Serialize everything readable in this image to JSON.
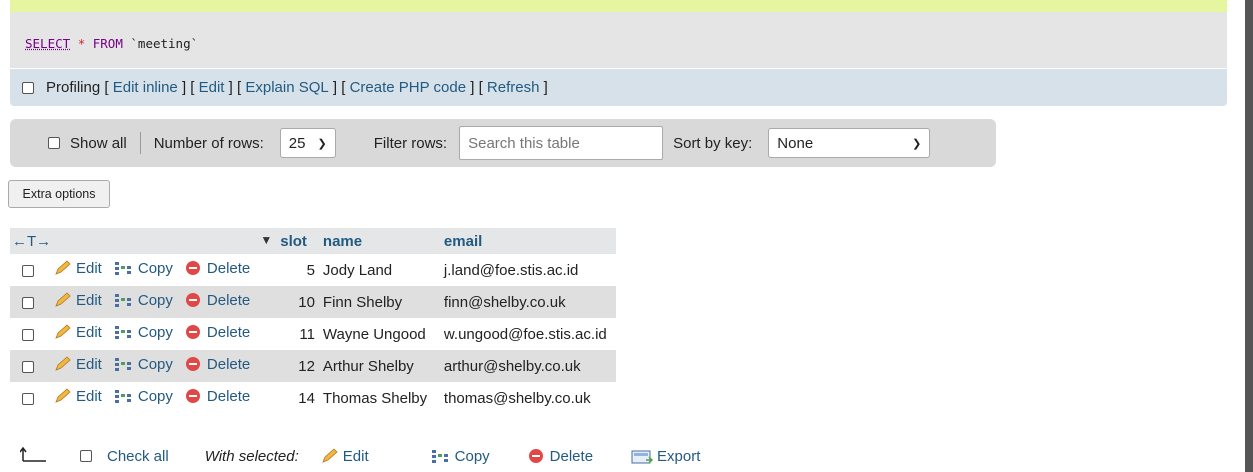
{
  "sql": {
    "select": "SELECT",
    "star": "*",
    "from": "FROM",
    "table": "`meeting`"
  },
  "profiling": {
    "label": "Profiling",
    "links": [
      "Edit inline",
      "Edit",
      "Explain SQL",
      "Create PHP code",
      "Refresh"
    ],
    "open": "[",
    "close": "]"
  },
  "nav": {
    "show_all": "Show all",
    "rows_label": "Number of rows:",
    "rows_value": "25",
    "filter_label": "Filter rows:",
    "filter_placeholder": "Search this table",
    "sort_label": "Sort by key:",
    "sort_value": "None"
  },
  "extra_options": "Extra options",
  "table": {
    "headers": {
      "arrows": "←T→",
      "slot": "slot",
      "name": "name",
      "email": "email"
    },
    "actions": {
      "edit": "Edit",
      "copy": "Copy",
      "delete": "Delete"
    },
    "rows": [
      {
        "slot": "5",
        "name": "Jody Land",
        "email": "j.land@foe.stis.ac.id"
      },
      {
        "slot": "10",
        "name": "Finn Shelby",
        "email": "finn@shelby.co.uk"
      },
      {
        "slot": "11",
        "name": "Wayne Ungood",
        "email": "w.ungood@foe.stis.ac.id"
      },
      {
        "slot": "12",
        "name": "Arthur Shelby",
        "email": "arthur@shelby.co.uk"
      },
      {
        "slot": "14",
        "name": "Thomas Shelby",
        "email": "thomas@shelby.co.uk"
      }
    ]
  },
  "bottom": {
    "check_all": "Check all",
    "with_selected": "With selected:",
    "edit": "Edit",
    "copy": "Copy",
    "delete": "Delete",
    "export": "Export"
  },
  "colors": {
    "link": "#235a81",
    "sql_keyword": "#770088",
    "sql_operator": "#dd2222",
    "delete_red": "#e04848"
  }
}
